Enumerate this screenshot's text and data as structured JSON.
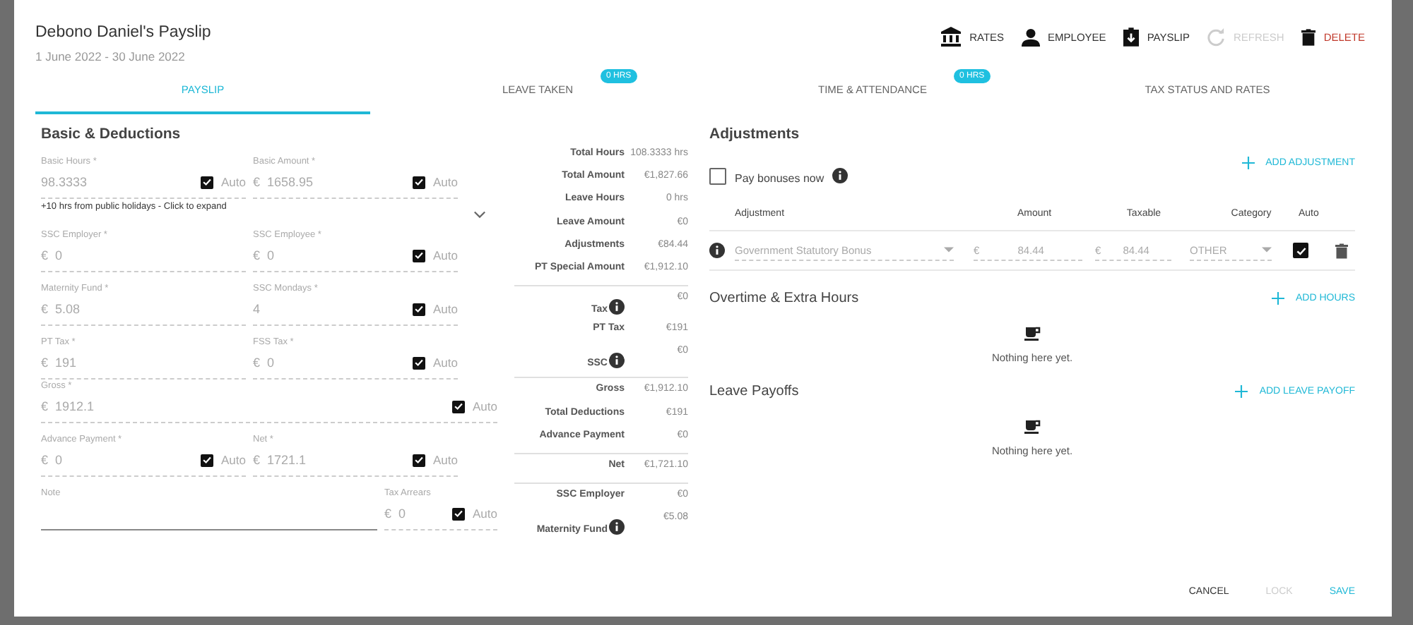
{
  "window": {
    "title": "Debono Daniel's Payslip",
    "subtitle": "1 June 2022 - 30 June 2022"
  },
  "actions": [
    {
      "kind": "bank",
      "label": "RATES",
      "disabled": false
    },
    {
      "kind": "person",
      "label": "EMPLOYEE",
      "disabled": false
    },
    {
      "kind": "clipboard",
      "label": "PAYSLIP",
      "disabled": false
    },
    {
      "kind": "refresh",
      "label": "REFRESH",
      "disabled": true
    },
    {
      "kind": "trash",
      "label": "DELETE",
      "disabled": false
    }
  ],
  "tabs": [
    {
      "label": "PAYSLIP",
      "selected": true
    },
    {
      "label": "LEAVE TAKEN",
      "badge": "0 HRS",
      "selected": false
    },
    {
      "label": "TIME & ATTENDANCE",
      "badge": "0 HRS",
      "selected": false
    },
    {
      "label": "TAX STATUS AND RATES",
      "selected": false
    }
  ],
  "basic": {
    "title": "Basic & Deductions",
    "rows": [
      {
        "fields": [
          {
            "kind": "half",
            "label": "Basic Hours *",
            "value": "98.3333",
            "auto": {
              "label": "Auto",
              "checked": true
            }
          },
          {
            "kind": "half",
            "label": "Basic Amount *",
            "prefix": "€",
            "value": "1658.95",
            "auto": {
              "label": "Auto",
              "checked": true
            }
          }
        ],
        "hint": "+10 hrs from public holidays - Click to expand"
      },
      {
        "fields": [
          {
            "kind": "half",
            "label": "SSC Employer *",
            "prefix": "€",
            "value": "0"
          },
          {
            "kind": "half",
            "label": "SSC Employee *",
            "prefix": "€",
            "value": "0",
            "auto": {
              "label": "Auto",
              "checked": true
            }
          }
        ]
      },
      {
        "fields": [
          {
            "kind": "half",
            "label": "Maternity Fund *",
            "prefix": "€",
            "value": "5.08"
          },
          {
            "kind": "half",
            "label": "SSC Mondays *",
            "value": "4",
            "auto": {
              "label": "Auto",
              "checked": true
            }
          }
        ]
      },
      {
        "fields": [
          {
            "kind": "half",
            "label": "PT Tax *",
            "prefix": "€",
            "value": "191"
          },
          {
            "kind": "half",
            "label": "FSS Tax *",
            "prefix": "€",
            "value": "0",
            "auto": {
              "label": "Auto",
              "checked": true
            }
          }
        ]
      },
      {
        "fields": [
          {
            "kind": "full",
            "label": "Gross *",
            "prefix": "€",
            "value": "1912.1",
            "auto": {
              "label": "Auto",
              "checked": true
            }
          }
        ]
      },
      {
        "fields": [
          {
            "kind": "half",
            "label": "Advance Payment *",
            "prefix": "€",
            "value": "0",
            "auto": {
              "label": "Auto",
              "checked": true
            }
          },
          {
            "kind": "half",
            "label": "Net *",
            "prefix": "€",
            "value": "1721.1",
            "auto": {
              "label": "Auto",
              "checked": true
            }
          }
        ]
      },
      {
        "fields": [
          {
            "kind": "wide",
            "label": "Note"
          },
          {
            "kind": "narrow",
            "label": "Tax Arrears",
            "prefix": "€",
            "value": "0",
            "auto": {
              "label": "Auto",
              "checked": true
            }
          }
        ]
      }
    ]
  },
  "summary": [
    [
      {
        "label": "Total Hours",
        "value": "108.3333 hrs"
      },
      {
        "label": "Total Amount",
        "value": "€1,827.66"
      },
      {
        "label": "Leave Hours",
        "value": "0 hrs"
      },
      {
        "label": "Leave Amount",
        "value": "€0"
      },
      {
        "label": "Adjustments",
        "value": "€84.44"
      },
      {
        "label": "PT Special Amount",
        "value": "€1,912.10"
      }
    ],
    [
      {
        "label": "Tax",
        "value": "€0",
        "info": true
      },
      {
        "label": "PT Tax",
        "value": "€191"
      },
      {
        "label": "SSC",
        "value": "€0",
        "info": true
      }
    ],
    [
      {
        "label": "Gross",
        "value": "€1,912.10"
      },
      {
        "label": "Total Deductions",
        "value": "€191"
      },
      {
        "label": "Advance Payment",
        "value": "€0"
      }
    ],
    [
      {
        "label": "Net",
        "value": "€1,721.10"
      }
    ],
    [
      {
        "label": "SSC Employer",
        "value": "€0"
      },
      {
        "label": "Maternity Fund",
        "value": "€5.08",
        "info": true
      }
    ]
  ],
  "adjustments": {
    "title": "Adjustments",
    "add": "ADD ADJUSTMENT",
    "pay_bonuses": {
      "label": "Pay bonuses now",
      "checked": false
    },
    "columns": [
      "Adjustment",
      "Amount",
      "Taxable",
      "Category",
      "Auto"
    ],
    "rows": [
      {
        "adjustment": "Government Statutory Bonus",
        "amount_prefix": "€",
        "amount": "84.44",
        "taxable_prefix": "€",
        "taxable": "84.44",
        "category": "OTHER",
        "auto": true
      }
    ]
  },
  "sections": [
    {
      "title": "Overtime & Extra Hours",
      "add": "ADD HOURS",
      "empty": "Nothing here yet."
    },
    {
      "title": "Leave Payoffs",
      "add": "ADD LEAVE PAYOFF",
      "empty": "Nothing here yet."
    }
  ],
  "footer": [
    {
      "label": "CANCEL",
      "kind": "plain",
      "disabled": false
    },
    {
      "label": "LOCK",
      "kind": "plain",
      "disabled": true
    },
    {
      "label": "SAVE",
      "kind": "primary",
      "disabled": false
    }
  ]
}
